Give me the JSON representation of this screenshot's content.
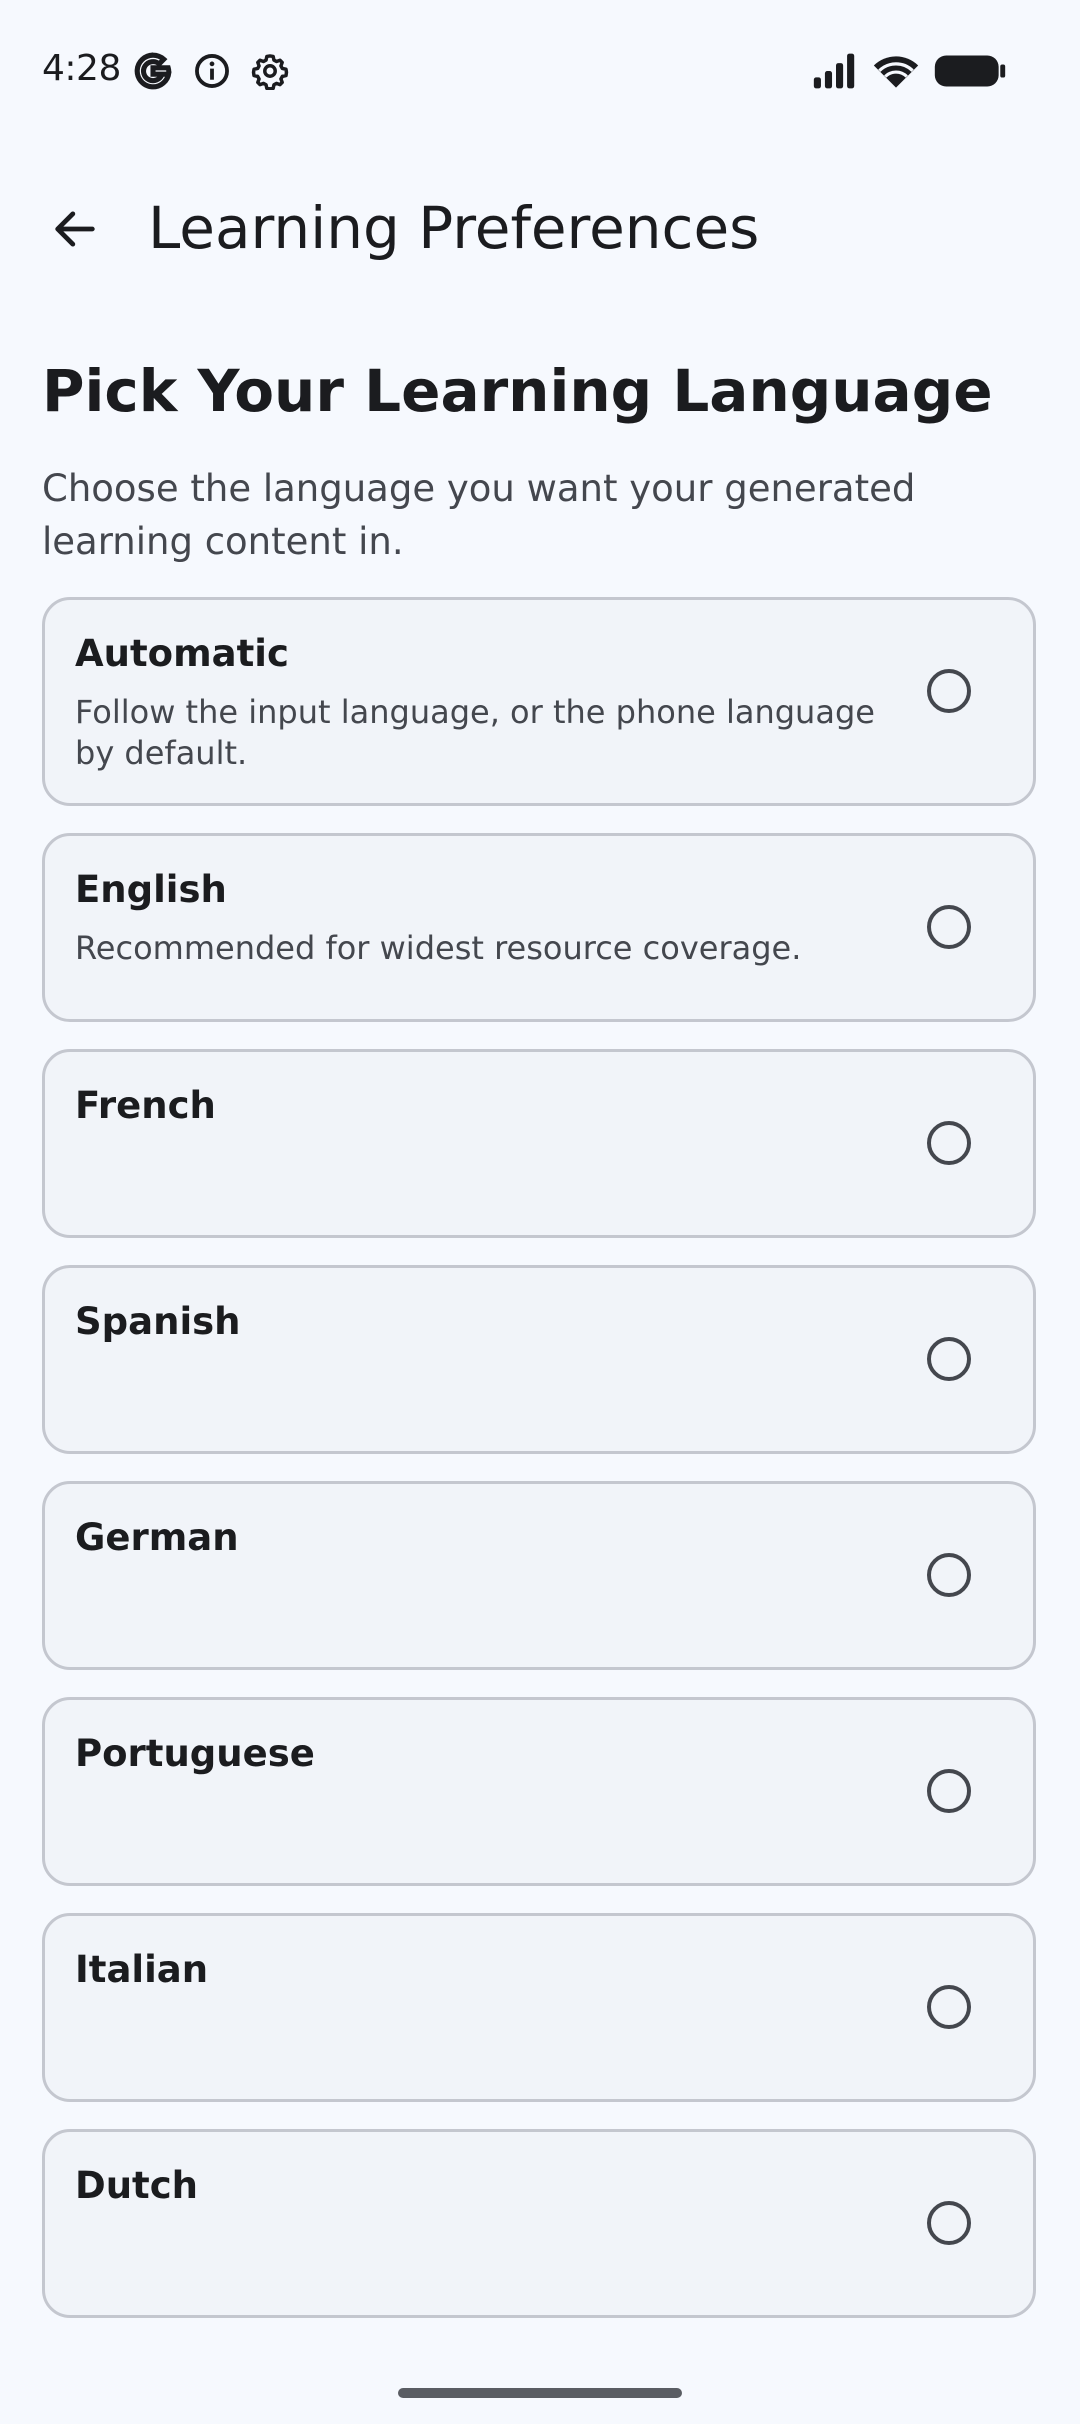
{
  "status_bar": {
    "time": "4:28",
    "left_icons": [
      "google-g-icon",
      "info-icon",
      "settings-gear-icon"
    ],
    "right_icons": [
      "signal-icon",
      "wifi-icon",
      "battery-icon"
    ]
  },
  "app_bar": {
    "back_icon": "arrow-back-icon",
    "title": "Learning Preferences"
  },
  "heading": "Pick Your Learning Language",
  "subtitle": "Choose the language you want your generated learning content in.",
  "options": [
    {
      "label": "Automatic",
      "description": "Follow the input language, or the phone language by default.",
      "selected": false
    },
    {
      "label": "English",
      "description": "Recommended for widest resource coverage.",
      "selected": false
    },
    {
      "label": "French",
      "description": "",
      "selected": false
    },
    {
      "label": "Spanish",
      "description": "",
      "selected": false
    },
    {
      "label": "German",
      "description": "",
      "selected": false
    },
    {
      "label": "Portuguese",
      "description": "",
      "selected": false
    },
    {
      "label": "Italian",
      "description": "",
      "selected": false
    },
    {
      "label": "Dutch",
      "description": "",
      "selected": false
    }
  ],
  "colors": {
    "background": "#f6f9fe",
    "card_background": "#f1f4f9",
    "card_border": "#c4c7cf",
    "text_primary": "#1b1c1f",
    "text_secondary": "#44474e"
  }
}
